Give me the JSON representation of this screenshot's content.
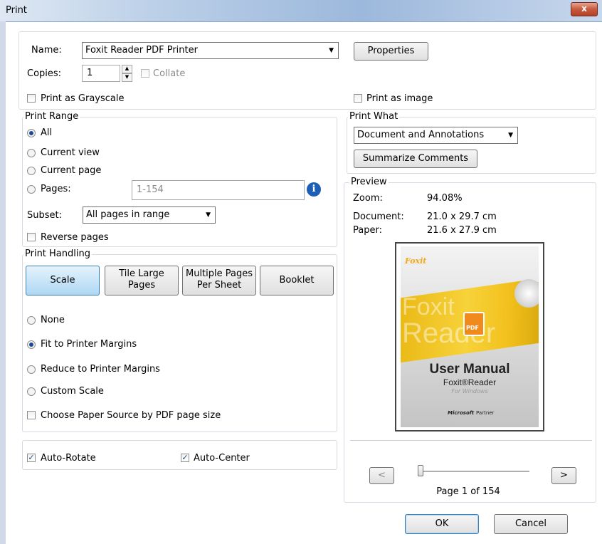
{
  "window": {
    "title": "Print",
    "close_glyph": "x"
  },
  "printer": {
    "name_label": "Name:",
    "name_value": "Foxit Reader PDF Printer",
    "properties_label": "Properties",
    "copies_label": "Copies:",
    "copies_value": "1",
    "collate_label": "Collate",
    "grayscale_label": "Print as Grayscale",
    "print_as_image_label": "Print as image"
  },
  "print_range": {
    "legend": "Print Range",
    "all_label": "All",
    "current_view_label": "Current view",
    "current_page_label": "Current page",
    "pages_label": "Pages:",
    "pages_placeholder": "1-154",
    "subset_label": "Subset:",
    "subset_value": "All pages in range",
    "reverse_label": "Reverse pages",
    "selected": "All"
  },
  "print_handling": {
    "legend": "Print Handling",
    "tabs": [
      "Scale",
      "Tile Large Pages",
      "Multiple Pages Per Sheet",
      "Booklet"
    ],
    "tab_scale": "Scale",
    "tab_tile_line1": "Tile Large",
    "tab_tile_line2": "Pages",
    "tab_multiple_line1": "Multiple Pages",
    "tab_multiple_line2": "Per Sheet",
    "tab_booklet": "Booklet",
    "active_tab": "Scale",
    "none_label": "None",
    "fit_label": "Fit to Printer Margins",
    "reduce_label": "Reduce to Printer Margins",
    "custom_label": "Custom Scale",
    "paper_source_label": "Choose Paper Source by PDF page size",
    "selected": "Fit to Printer Margins"
  },
  "options": {
    "auto_rotate_label": "Auto-Rotate",
    "auto_center_label": "Auto-Center",
    "auto_rotate_checked": true,
    "auto_center_checked": true
  },
  "print_what": {
    "legend": "Print What",
    "value": "Document and Annotations",
    "summarize_label": "Summarize Comments"
  },
  "preview": {
    "legend": "Preview",
    "zoom_label": "Zoom:",
    "zoom_value": "94.08%",
    "document_label": "Document:",
    "document_value": "21.0 x 29.7 cm",
    "paper_label": "Paper:",
    "paper_value": "21.6 x 27.9 cm",
    "cover": {
      "brand": "Foxit",
      "bg_word1": "Foxit",
      "bg_word2": "Reader",
      "pdf_badge": "PDF",
      "title": "User Manual",
      "product": "Foxit®Reader",
      "platform": "For Windows",
      "partner_brand": "Microsoft",
      "partner_word": "Partner"
    },
    "prev_label": "<",
    "next_label": ">",
    "page_indicator": "Page 1 of 154",
    "current_page": 1,
    "total_pages": 154
  },
  "footer": {
    "ok_label": "OK",
    "cancel_label": "Cancel"
  },
  "colors": {
    "accent": "#1d4a96",
    "brand": "#f5a81a",
    "cover_yellow": "#f2c01c"
  }
}
